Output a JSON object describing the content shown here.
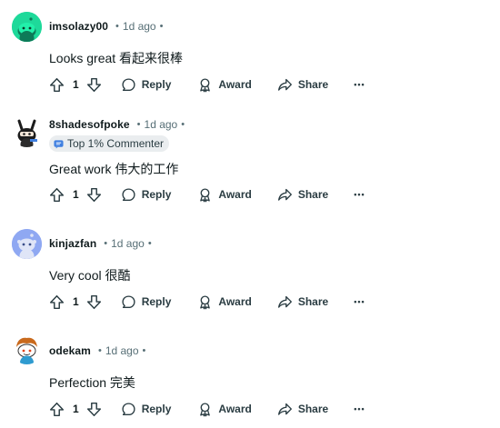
{
  "comments": [
    {
      "username": "imsolazy00",
      "time": "1d ago",
      "flair": null,
      "body": "Looks great  看起来很棒",
      "score": "1",
      "avatar": "snoo-green-avatar",
      "avatar_color": "#1ed99a"
    },
    {
      "username": "8shadesofpoke",
      "time": "1d ago",
      "flair": "Top 1% Commenter",
      "body": "Great work  伟大的工作",
      "score": "1",
      "avatar": "snoo-ninja-avatar",
      "avatar_color": "#ffffff"
    },
    {
      "username": "kinjazfan",
      "time": "1d ago",
      "flair": null,
      "body": "Very cool  很酷",
      "score": "1",
      "avatar": "snoo-blue-avatar",
      "avatar_color": "#8fa8f2"
    },
    {
      "username": "odekam",
      "time": "1d ago",
      "flair": null,
      "body": "Perfection  完美",
      "score": "1",
      "avatar": "snoo-hair-avatar",
      "avatar_color": "#ffffff"
    }
  ],
  "actions": {
    "reply": "Reply",
    "award": "Award",
    "share": "Share",
    "more": "•••"
  },
  "separator": "•",
  "icons": {
    "upvote": "upvote-arrow-icon",
    "downvote": "downvote-arrow-icon",
    "reply": "speech-bubble-icon",
    "award": "award-ribbon-icon",
    "share": "share-arrow-icon",
    "more": "ellipsis-icon",
    "flair": "commenter-badge-icon"
  },
  "colors": {
    "text": "#0f1a1c",
    "meta": "#576f76",
    "flair_bg": "#eaedef",
    "time": "#576f76"
  }
}
